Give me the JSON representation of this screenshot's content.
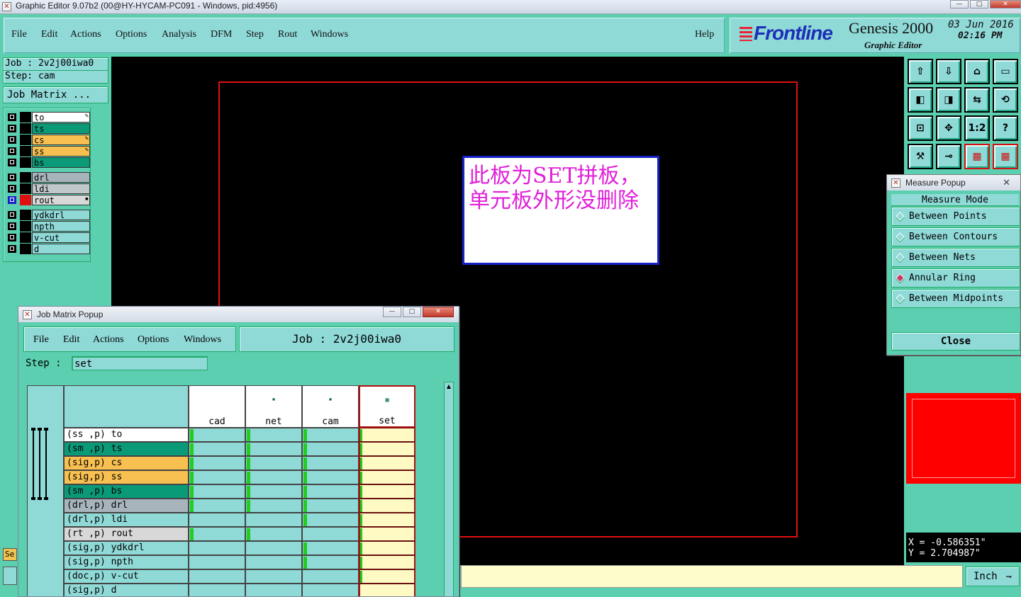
{
  "window": {
    "title": "Graphic Editor 9.07b2 (00@HY-HYCAM-PC091 - Windows, pid:4956)"
  },
  "menu": {
    "file": "File",
    "edit": "Edit",
    "actions": "Actions",
    "options": "Options",
    "analysis": "Analysis",
    "dfm": "DFM",
    "step": "Step",
    "rout": "Rout",
    "windows": "Windows",
    "help": "Help"
  },
  "brand": {
    "logo": "Frontline",
    "product": "Genesis 2000",
    "subtitle": "Graphic Editor",
    "date": "03 Jun 2016",
    "time": "02:16 PM"
  },
  "job": {
    "job_line": "Job : 2v2j00iwa0",
    "step_line": "Step: cam",
    "matrix_button": "Job Matrix ..."
  },
  "layers": [
    {
      "name": "to",
      "color": "#ffffff",
      "swatch": "#000000",
      "mark": "✎"
    },
    {
      "name": "ts",
      "color": "#0a9a78",
      "swatch": "#000000",
      "mark": ""
    },
    {
      "name": "cs",
      "color": "#f8c050",
      "swatch": "#000000",
      "mark": "✎"
    },
    {
      "name": "ss",
      "color": "#f8c050",
      "swatch": "#000000",
      "mark": "✎"
    },
    {
      "name": "bs",
      "color": "#0a9a78",
      "swatch": "#000000",
      "mark": ""
    },
    {
      "name": "drl",
      "color": "#a8b4bc",
      "swatch": "#000000",
      "mark": ""
    },
    {
      "name": "ldi",
      "color": "#c0c8cc",
      "swatch": "#000000",
      "mark": ""
    },
    {
      "name": "rout",
      "color": "#d8d8d8",
      "swatch": "#e01010",
      "mark": "▪",
      "active": true
    },
    {
      "name": "ydkdrl",
      "color": "#8fd9d7",
      "swatch": "#000000",
      "mark": ""
    },
    {
      "name": "npth",
      "color": "#8fd9d7",
      "swatch": "#000000",
      "mark": ""
    },
    {
      "name": "v-cut",
      "color": "#8fd9d7",
      "swatch": "#000000",
      "mark": ""
    },
    {
      "name": "d",
      "color": "#8fd9d7",
      "swatch": "#000000",
      "mark": ""
    }
  ],
  "canvas": {
    "note": "此板为SET拼板，单元板外形没删除"
  },
  "toolbar": {
    "icons": [
      "home-up-icon",
      "home-down-icon",
      "house-icon",
      "window-icon",
      "pan-left-icon",
      "pan-right-icon",
      "mirror-icon",
      "rotate-icon",
      "fit-all-icon",
      "zoom-center-icon",
      "one-to-one-icon",
      "help-icon",
      "tools-icon",
      "probe-icon",
      "board-layers-icon",
      "board-layers-red-icon"
    ],
    "one_to_one": "1:2",
    "help": "?"
  },
  "measure": {
    "title": "Measure Popup",
    "mode_header": "Measure Mode",
    "options": [
      {
        "label": "Between Points",
        "selected": false
      },
      {
        "label": "Between Contours",
        "selected": false
      },
      {
        "label": "Between Nets",
        "selected": false
      },
      {
        "label": "Annular Ring",
        "selected": true
      },
      {
        "label": "Between Midpoints",
        "selected": false
      }
    ],
    "close": "Close"
  },
  "coords": {
    "x": "X = -0.586351\"",
    "y": "Y = 2.704987\""
  },
  "units": {
    "label": "Inch"
  },
  "frag": {
    "se": "Se"
  },
  "job_matrix": {
    "title": "Job Matrix Popup",
    "menu": {
      "file": "File",
      "edit": "Edit",
      "actions": "Actions",
      "options": "Options",
      "windows": "Windows"
    },
    "job": "Job : 2v2j00iwa0",
    "step_label": "Step :",
    "step_value": "set",
    "steps": [
      "cad",
      "net",
      "cam",
      "set"
    ],
    "rows": [
      {
        "label": "(ss ,p) to",
        "color": "#ffffff",
        "cells": [
          true,
          true,
          true,
          true
        ]
      },
      {
        "label": "(sm ,p) ts",
        "color": "#0a9a78",
        "cells": [
          true,
          true,
          true,
          true
        ]
      },
      {
        "label": "(sig,p) cs",
        "color": "#f8c050",
        "cells": [
          true,
          true,
          true,
          true
        ]
      },
      {
        "label": "(sig,p) ss",
        "color": "#f8c050",
        "cells": [
          true,
          true,
          true,
          true
        ]
      },
      {
        "label": "(sm ,p) bs",
        "color": "#0a9a78",
        "cells": [
          true,
          true,
          true,
          true
        ]
      },
      {
        "label": "(drl,p) drl",
        "color": "#a8b4bc",
        "cells": [
          true,
          true,
          true,
          true
        ]
      },
      {
        "label": "(drl,p) ldi",
        "color": "#8fd9d7",
        "cells": [
          false,
          false,
          true,
          true
        ]
      },
      {
        "label": "(rt ,p) rout",
        "color": "#d8d8d8",
        "cells": [
          true,
          true,
          false,
          true
        ]
      },
      {
        "label": "(sig,p) ydkdrl",
        "color": "#8fd9d7",
        "cells": [
          false,
          false,
          true,
          true
        ]
      },
      {
        "label": "(sig,p) npth",
        "color": "#8fd9d7",
        "cells": [
          false,
          false,
          true,
          true
        ]
      },
      {
        "label": "(doc,p) v-cut",
        "color": "#8fd9d7",
        "cells": [
          false,
          false,
          false,
          true
        ]
      },
      {
        "label": "(sig,p) d",
        "color": "#8fd9d7",
        "cells": [
          false,
          false,
          false,
          false
        ]
      }
    ]
  }
}
